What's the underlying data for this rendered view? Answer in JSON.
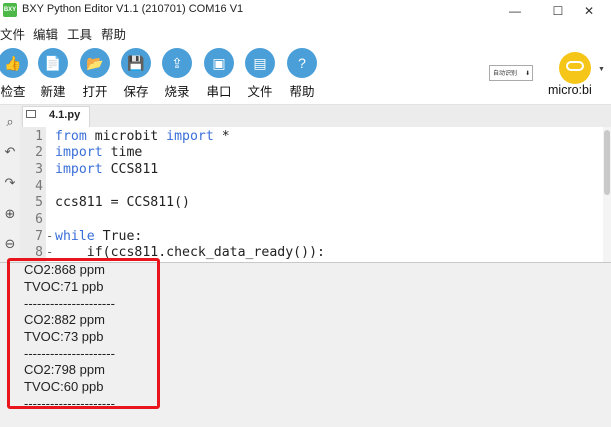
{
  "window": {
    "title": "BXY Python Editor V1.1 (210701) COM16 V1",
    "logo_text": "BXY",
    "minimize_label": "—",
    "maximize_label": "☐",
    "close_label": "✕"
  },
  "menu": [
    "文件",
    "编辑",
    "工具",
    "帮助"
  ],
  "toolbar": {
    "buttons": [
      {
        "label": "检查",
        "icon": "thumbs-up-icon",
        "glyph": "👍",
        "color": "#4a9fd8"
      },
      {
        "label": "新建",
        "icon": "new-file-icon",
        "glyph": "📄",
        "color": "#4a9fd8"
      },
      {
        "label": "打开",
        "icon": "folder-icon",
        "glyph": "📂",
        "color": "#4a9fd8"
      },
      {
        "label": "保存",
        "icon": "save-icon",
        "glyph": "💾",
        "color": "#4a9fd8"
      },
      {
        "label": "烧录",
        "icon": "upload-icon",
        "glyph": "⇪",
        "color": "#4a9fd8"
      },
      {
        "label": "串口",
        "icon": "serial-port-icon",
        "glyph": "▣",
        "color": "#4a9fd8"
      },
      {
        "label": "文件",
        "icon": "files-icon",
        "glyph": "▤",
        "color": "#4a9fd8"
      },
      {
        "label": "帮助",
        "icon": "help-icon",
        "glyph": "?",
        "color": "#4a9fd8"
      }
    ],
    "mode_select": "自动识别",
    "device_label": "micro:bi"
  },
  "tab": {
    "label": "4.1.py"
  },
  "editor": {
    "line_numbers": [
      "1",
      "2",
      "3",
      "4",
      "5",
      "6",
      "7",
      "8"
    ],
    "lines": [
      {
        "kw1": "from",
        "text": " microbit ",
        "kw2": "import",
        "rest": " *"
      },
      {
        "kw1": "import",
        "text": " time",
        "kw2": "",
        "rest": ""
      },
      {
        "kw1": "import",
        "text": " CCS811",
        "kw2": "",
        "rest": ""
      },
      {
        "kw1": "",
        "text": "",
        "kw2": "",
        "rest": ""
      },
      {
        "kw1": "",
        "text": "ccs811 = CCS811()",
        "kw2": "",
        "rest": ""
      },
      {
        "kw1": "",
        "text": "",
        "kw2": "",
        "rest": ""
      },
      {
        "kw1": "while",
        "text": " True:",
        "kw2": "",
        "rest": ""
      },
      {
        "kw1": "",
        "text": "    if(ccs811.check_data_ready()):",
        "kw2": "",
        "rest": ""
      }
    ]
  },
  "console": {
    "lines": [
      "CO2:868 ppm",
      "TVOC:71 ppb",
      "---------------------",
      "CO2:882 ppm",
      "TVOC:73 ppb",
      "---------------------",
      "CO2:798 ppm",
      "TVOC:60 ppb",
      "---------------------"
    ]
  },
  "colors": {
    "accent": "#4a9fd8",
    "highlight": "#e8161c",
    "keyword": "#3a6fd8",
    "microbit": "#f5c518"
  }
}
